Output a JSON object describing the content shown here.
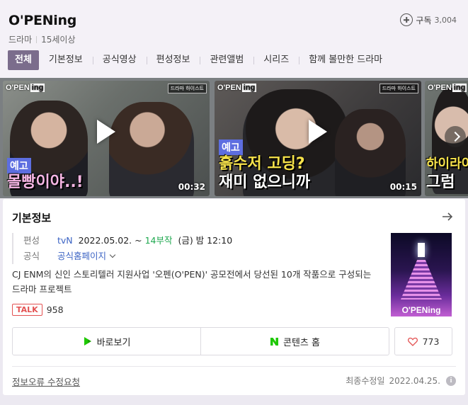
{
  "header": {
    "title": "O'PENing",
    "genre": "드라마",
    "rating": "15세이상",
    "subscribe_label": "구독",
    "subscribe_count": "3,004"
  },
  "tabs": [
    {
      "label": "전체",
      "active": true
    },
    {
      "label": "기본정보"
    },
    {
      "label": "공식영상"
    },
    {
      "label": "편성정보"
    },
    {
      "label": "관련앨범"
    },
    {
      "label": "시리즈"
    },
    {
      "label": "함께 볼만한 드라마"
    }
  ],
  "videos": [
    {
      "brand": "O'PEN",
      "brand_suffix": "ing",
      "channel_logo": "드라마 하이스트",
      "tag": "예고",
      "caption": "몰빵이야..!",
      "duration": "00:32"
    },
    {
      "brand": "O'PEN",
      "brand_suffix": "ing",
      "channel_logo": "드라마 하이스트",
      "tag": "예고",
      "caption_line1": "흙수저 고딩?",
      "caption_line2": "재미 없으니까",
      "duration": "00:15"
    },
    {
      "brand": "O'PEN",
      "brand_suffix": "ing",
      "caption_line1": "하이라이",
      "caption_line2": "그럼"
    }
  ],
  "basic_info": {
    "section_title": "기본정보",
    "broadcast_label": "편성",
    "channel": "tvN",
    "date": "2022.05.02. ~",
    "episodes": "14부작",
    "schedule": "(금) 밤 12:10",
    "official_label": "공식",
    "official_link": "공식홈페이지",
    "description": "CJ ENM의 신인 스토리텔러 지원사업 '오펜(O'PEN)' 공모전에서 당선된 10개 작품으로 구성되는 드라마 프로젝트",
    "talk_label": "TALK",
    "talk_count": "958",
    "poster_title": "O'PENing",
    "watch_label": "바로보기",
    "content_home_label": "콘텐츠 홈",
    "like_count": "773",
    "report_label": "정보오류 수정요청",
    "updated_label": "최종수정일",
    "updated_date": "2022.04.25."
  },
  "colors": {
    "active_tab": "#7b6d8c",
    "green": "#1fa84f",
    "link": "#3b63c4",
    "talk_red": "#e35252",
    "caption_tag": "#5d6ee0"
  }
}
